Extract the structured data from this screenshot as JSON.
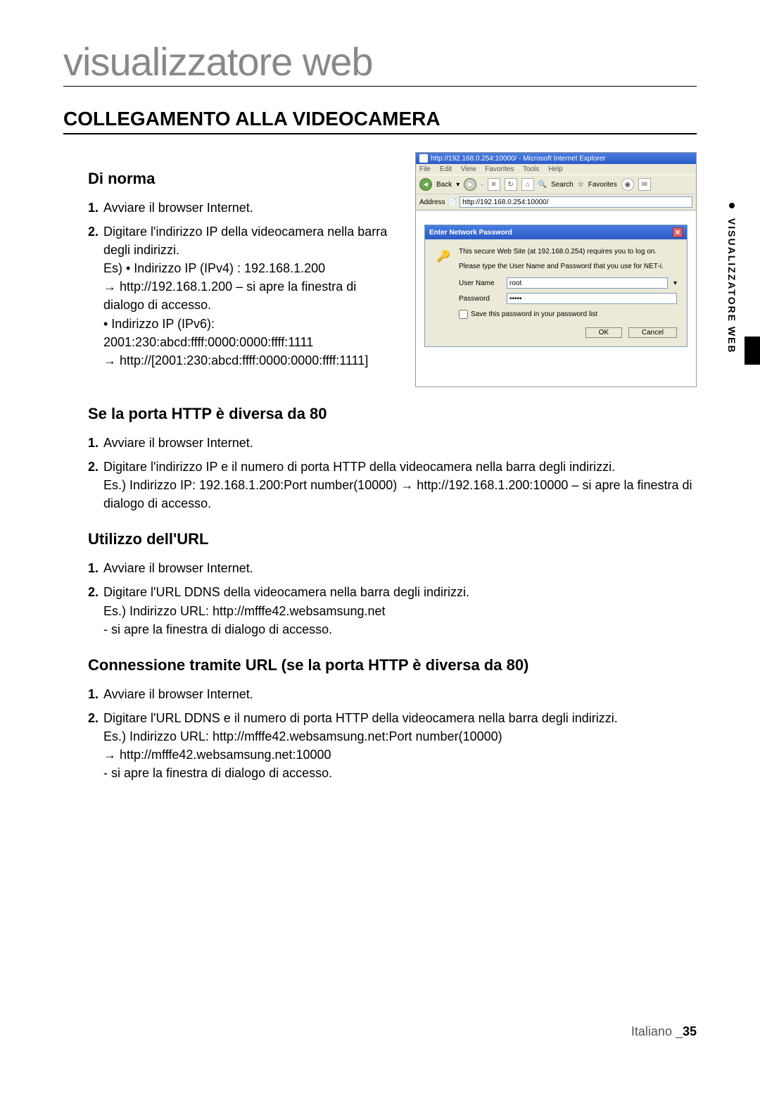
{
  "chapter": "visualizzatore web",
  "section": "COLLEGAMENTO ALLA VIDEOCAMERA",
  "sideTab": "VISUALIZZATORE WEB",
  "sub1": {
    "title": "Di norma",
    "item1": "Avviare il browser Internet.",
    "item2": "Digitare l'indirizzo IP della videocamera nella barra degli indirizzi.\nEs) • Indirizzo IP (IPv4) : 192.168.1.200\n→ http://192.168.1.200 – si apre la finestra di dialogo di accesso.\n• Indirizzo IP (IPv6): 2001:230:abcd:ffff:0000:0000:ffff:1111\n→ http://[2001:230:abcd:ffff:0000:0000:ffff:1111]"
  },
  "sub2": {
    "title": "Se la porta HTTP è diversa da 80",
    "item1": "Avviare il browser Internet.",
    "item2": "Digitare l'indirizzo IP e il numero di porta HTTP della videocamera nella barra degli indirizzi.\nEs.) Indirizzo IP: 192.168.1.200:Port number(10000) → http://192.168.1.200:10000 – si apre la finestra di dialogo di accesso."
  },
  "sub3": {
    "title": "Utilizzo dell'URL",
    "item1": "Avviare il browser Internet.",
    "item2": "Digitare l'URL DDNS della videocamera nella barra degli indirizzi.\nEs.) Indirizzo URL: http://mfffe42.websamsung.net\n- si apre la finestra di dialogo di accesso."
  },
  "sub4": {
    "title": "Connessione tramite URL (se la porta HTTP è diversa da 80)",
    "item1": "Avviare il browser Internet.",
    "item2": "Digitare l'URL DDNS e il numero di porta HTTP della videocamera nella barra degli indirizzi.\nEs.) Indirizzo URL: http://mfffe42.websamsung.net:Port number(10000)\n→ http://mfffe42.websamsung.net:10000\n- si apre la finestra di dialogo di accesso."
  },
  "ie": {
    "title": "http://192.168.0.254:10000/ - Microsoft Internet Explorer",
    "menu": {
      "file": "File",
      "edit": "Edit",
      "view": "View",
      "fav": "Favorites",
      "tools": "Tools",
      "help": "Help"
    },
    "toolbar": {
      "back": "Back",
      "search": "Search",
      "favorites": "Favorites"
    },
    "addrLabel": "Address",
    "addrValue": "http://192.168.0.254:10000/",
    "dialog": {
      "title": "Enter Network Password",
      "line1": "This secure Web Site (at 192.168.0.254) requires you to log on.",
      "line2": "Please type the User Name and Password that you use for NET-i.",
      "userLabel": "User Name",
      "userValue": "root",
      "passLabel": "Password",
      "passValue": "•••••",
      "saveLabel": "Save this password in your password list",
      "ok": "OK",
      "cancel": "Cancel"
    }
  },
  "footer": {
    "lang": "Italiano _",
    "page": "35"
  }
}
